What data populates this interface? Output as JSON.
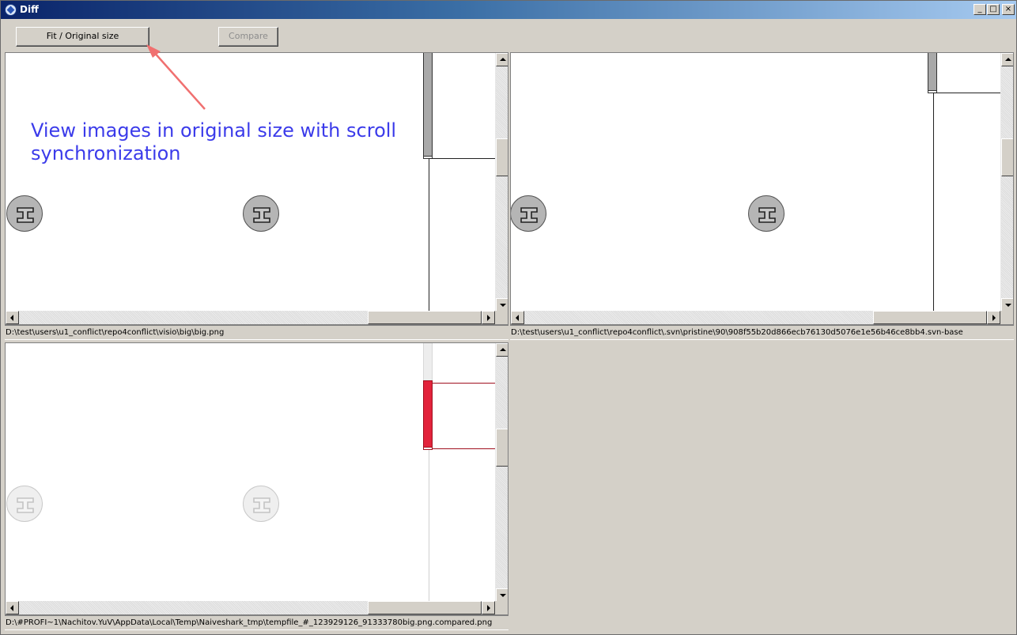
{
  "window": {
    "title": "Diff",
    "minimize": "_",
    "maximize": "□",
    "close": "×"
  },
  "toolbar": {
    "fit_label": "Fit / Original size",
    "compare_label": "Compare"
  },
  "annotation": {
    "text": "View images in original size with scroll synchronization"
  },
  "panes": {
    "left_top": {
      "path": "D:\\test\\users\\u1_conflict\\repo4conflict\\visio\\big\\big.png"
    },
    "right_top": {
      "path": "D:\\test\\users\\u1_conflict\\repo4conflict\\.svn\\pristine\\90\\908f55b20d866ecb76130d5076e1e56b46ce8bb4.svn-base"
    },
    "bottom": {
      "path": "D:\\#PROFI~1\\Nachitov.YuV\\AppData\\Local\\Temp\\Naiveshark_tmp\\tempfile_#_123929126_91333780big.png.compared.png"
    }
  },
  "icons": {
    "app": "diff-app-icon",
    "stencil": "steel-beam-icon",
    "arrow": "annotation-arrow"
  },
  "colors": {
    "accent_annotation": "#3b3bea",
    "diff_highlight": "#e2233b",
    "arrow": "#f07070"
  }
}
